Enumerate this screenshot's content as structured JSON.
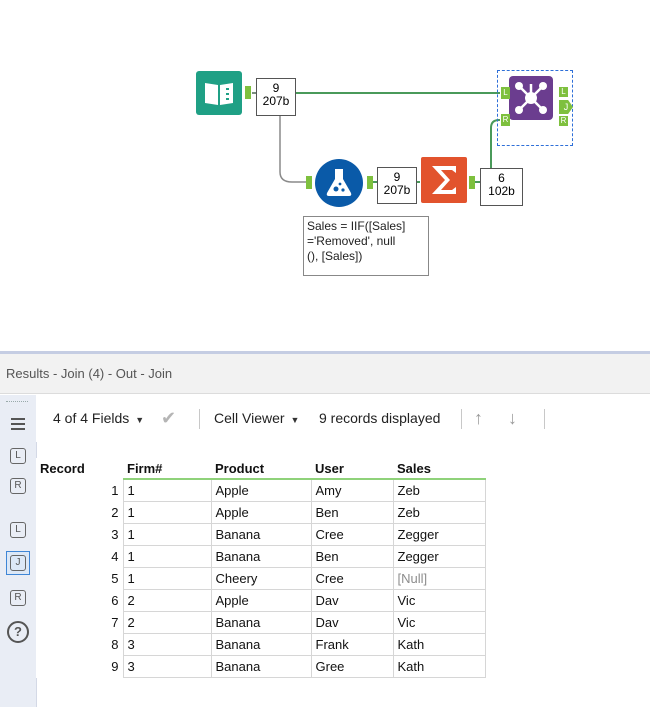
{
  "workflow": {
    "input_counts": {
      "records": "9",
      "size": "207b"
    },
    "formula_counts": {
      "records": "9",
      "size": "207b"
    },
    "summarize_counts": {
      "records": "6",
      "size": "102b"
    },
    "formula_annotation": "Sales = IIF([Sales]\n='Removed', null\n(), [Sales])",
    "join_anchor_labels": {
      "left": "L",
      "right": "R",
      "out_j": "J",
      "out_l": "L",
      "out_r": "R"
    },
    "colors": {
      "input": "#1fa085",
      "formula": "#0a5aa8",
      "summarize": "#e2532d",
      "join": "#6b3d8f",
      "wire": "#4a9a5a",
      "anchor": "#7ec03e"
    }
  },
  "results": {
    "title": "Results - Join (4) - Out - Join",
    "fields_dropdown": "4 of 4 Fields",
    "cell_viewer": "Cell Viewer",
    "records_status": "9 records displayed",
    "sidebar_icons": [
      "list-icon",
      "left-anchor-sum-icon",
      "right-anchor-sum-icon",
      "anchor-L-icon",
      "anchor-J-icon",
      "anchor-R-icon",
      "help-icon"
    ],
    "sidebar_labels": {
      "left_sum": "L",
      "right_sum": "R",
      "L": "L",
      "J": "J",
      "R": "R",
      "help": "?"
    },
    "columns": [
      "Record",
      "Firm#",
      "Product",
      "User",
      "Sales"
    ],
    "rows": [
      [
        "1",
        "1",
        "Apple",
        "Amy",
        "Zeb"
      ],
      [
        "2",
        "1",
        "Apple",
        "Ben",
        "Zeb"
      ],
      [
        "3",
        "1",
        "Banana",
        "Cree",
        "Zegger"
      ],
      [
        "4",
        "1",
        "Banana",
        "Ben",
        "Zegger"
      ],
      [
        "5",
        "1",
        "Cheery",
        "Cree",
        "[Null]"
      ],
      [
        "6",
        "2",
        "Apple",
        "Dav",
        "Vic"
      ],
      [
        "7",
        "2",
        "Banana",
        "Dav",
        "Vic"
      ],
      [
        "8",
        "3",
        "Banana",
        "Frank",
        "Kath"
      ],
      [
        "9",
        "3",
        "Banana",
        "Gree",
        "Kath"
      ]
    ]
  }
}
